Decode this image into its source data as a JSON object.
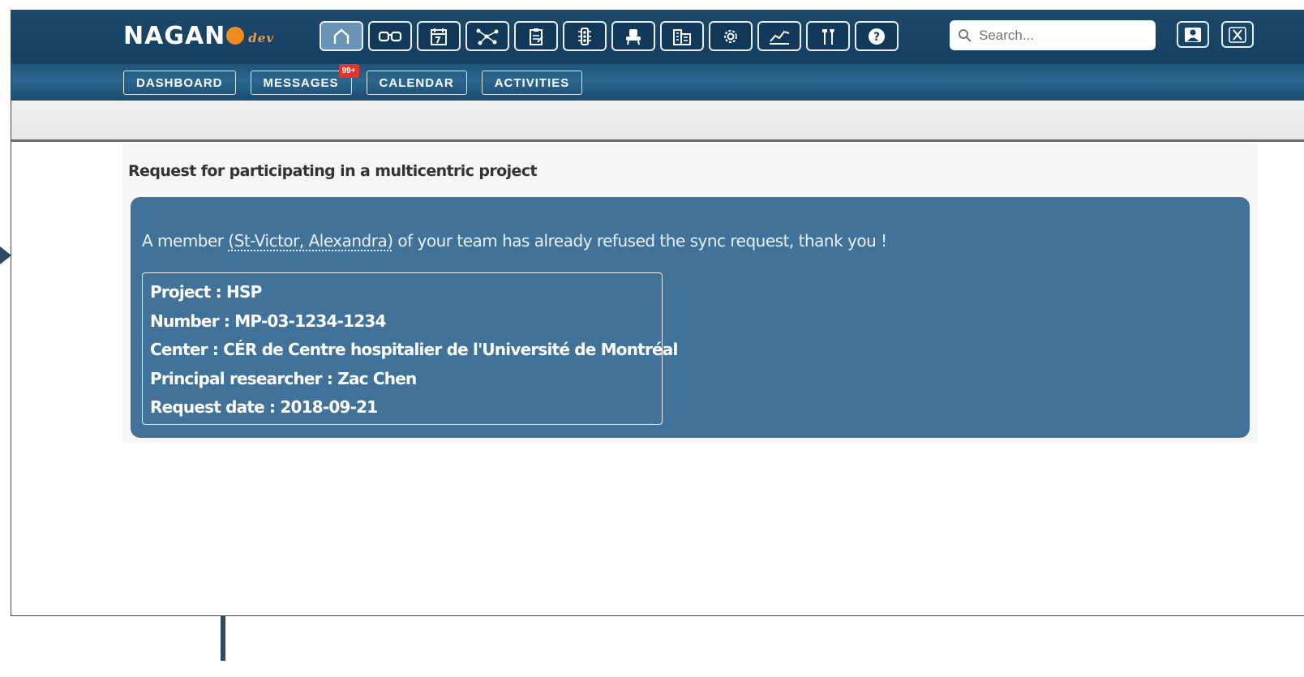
{
  "header": {
    "logo_text": "NAGAN",
    "logo_suffix": "dev",
    "icons": [
      {
        "name": "home-icon",
        "active": true
      },
      {
        "name": "glasses-icon",
        "active": false
      },
      {
        "name": "calendar-icon",
        "active": false
      },
      {
        "name": "network-icon",
        "active": false
      },
      {
        "name": "clipboard-icon",
        "active": false
      },
      {
        "name": "traffic-light-icon",
        "active": false
      },
      {
        "name": "chair-icon",
        "active": false
      },
      {
        "name": "building-icon",
        "active": false
      },
      {
        "name": "gear-icon",
        "active": false
      },
      {
        "name": "chart-line-icon",
        "active": false
      },
      {
        "name": "tools-icon",
        "active": false
      },
      {
        "name": "help-icon",
        "active": false
      }
    ],
    "search_placeholder": "Search...",
    "right_icons": [
      "user-icon",
      "close-icon"
    ]
  },
  "nav": {
    "dashboard": "DASHBOARD",
    "messages": "MESSAGES",
    "messages_badge": "99+",
    "calendar": "CALENDAR",
    "activities": "ACTIVITIES"
  },
  "page": {
    "title": "Request for participating in a multicentric project",
    "message_prefix": "A member ",
    "member": "(St-Victor, Alexandra)",
    "message_suffix": " of your team has already refused the sync request, thank you !",
    "details": {
      "project": "Project : HSP",
      "number": "Number : MP-03-1234-1234",
      "center": "Center : CÉR de Centre hospitalier de l'Université de Montréal",
      "principal": "Principal researcher : Zac Chen",
      "request_date": "Request date : 2018-09-21"
    }
  },
  "colors": {
    "header_bg": "#164063",
    "panel_bg": "#41729a",
    "badge": "#e5352b",
    "accent_orange": "#f38a1f",
    "annotation_arrow": "#2c4a60"
  }
}
